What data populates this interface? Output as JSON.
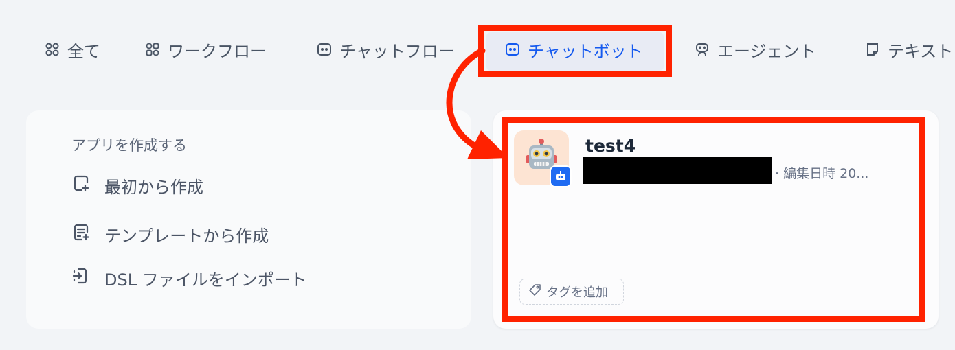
{
  "tabs": [
    {
      "label": "全て",
      "icon": "grid-icon"
    },
    {
      "label": "ワークフロー",
      "icon": "workflow-icon"
    },
    {
      "label": "チャットフロー",
      "icon": "chat-icon"
    },
    {
      "label": "チャットボット",
      "icon": "chat-icon",
      "active": true
    },
    {
      "label": "エージェント",
      "icon": "robot-icon"
    },
    {
      "label": "テキスト",
      "icon": "note-icon"
    }
  ],
  "create": {
    "title": "アプリを作成する",
    "items": [
      {
        "label": "最初から作成",
        "icon": "file-plus-icon"
      },
      {
        "label": "テンプレートから作成",
        "icon": "file-template-icon"
      },
      {
        "label": "DSL ファイルをインポート",
        "icon": "import-icon"
      }
    ]
  },
  "app_card": {
    "name": "test4",
    "meta": "· 編集日時 20...",
    "tag_add": "タグを追加",
    "avatar_emoji": "🤖",
    "avatar_bg": "#fde4d3"
  },
  "colors": {
    "accent": "#155aef",
    "highlight": "#ff2200",
    "badge": "#1f6bf2"
  }
}
